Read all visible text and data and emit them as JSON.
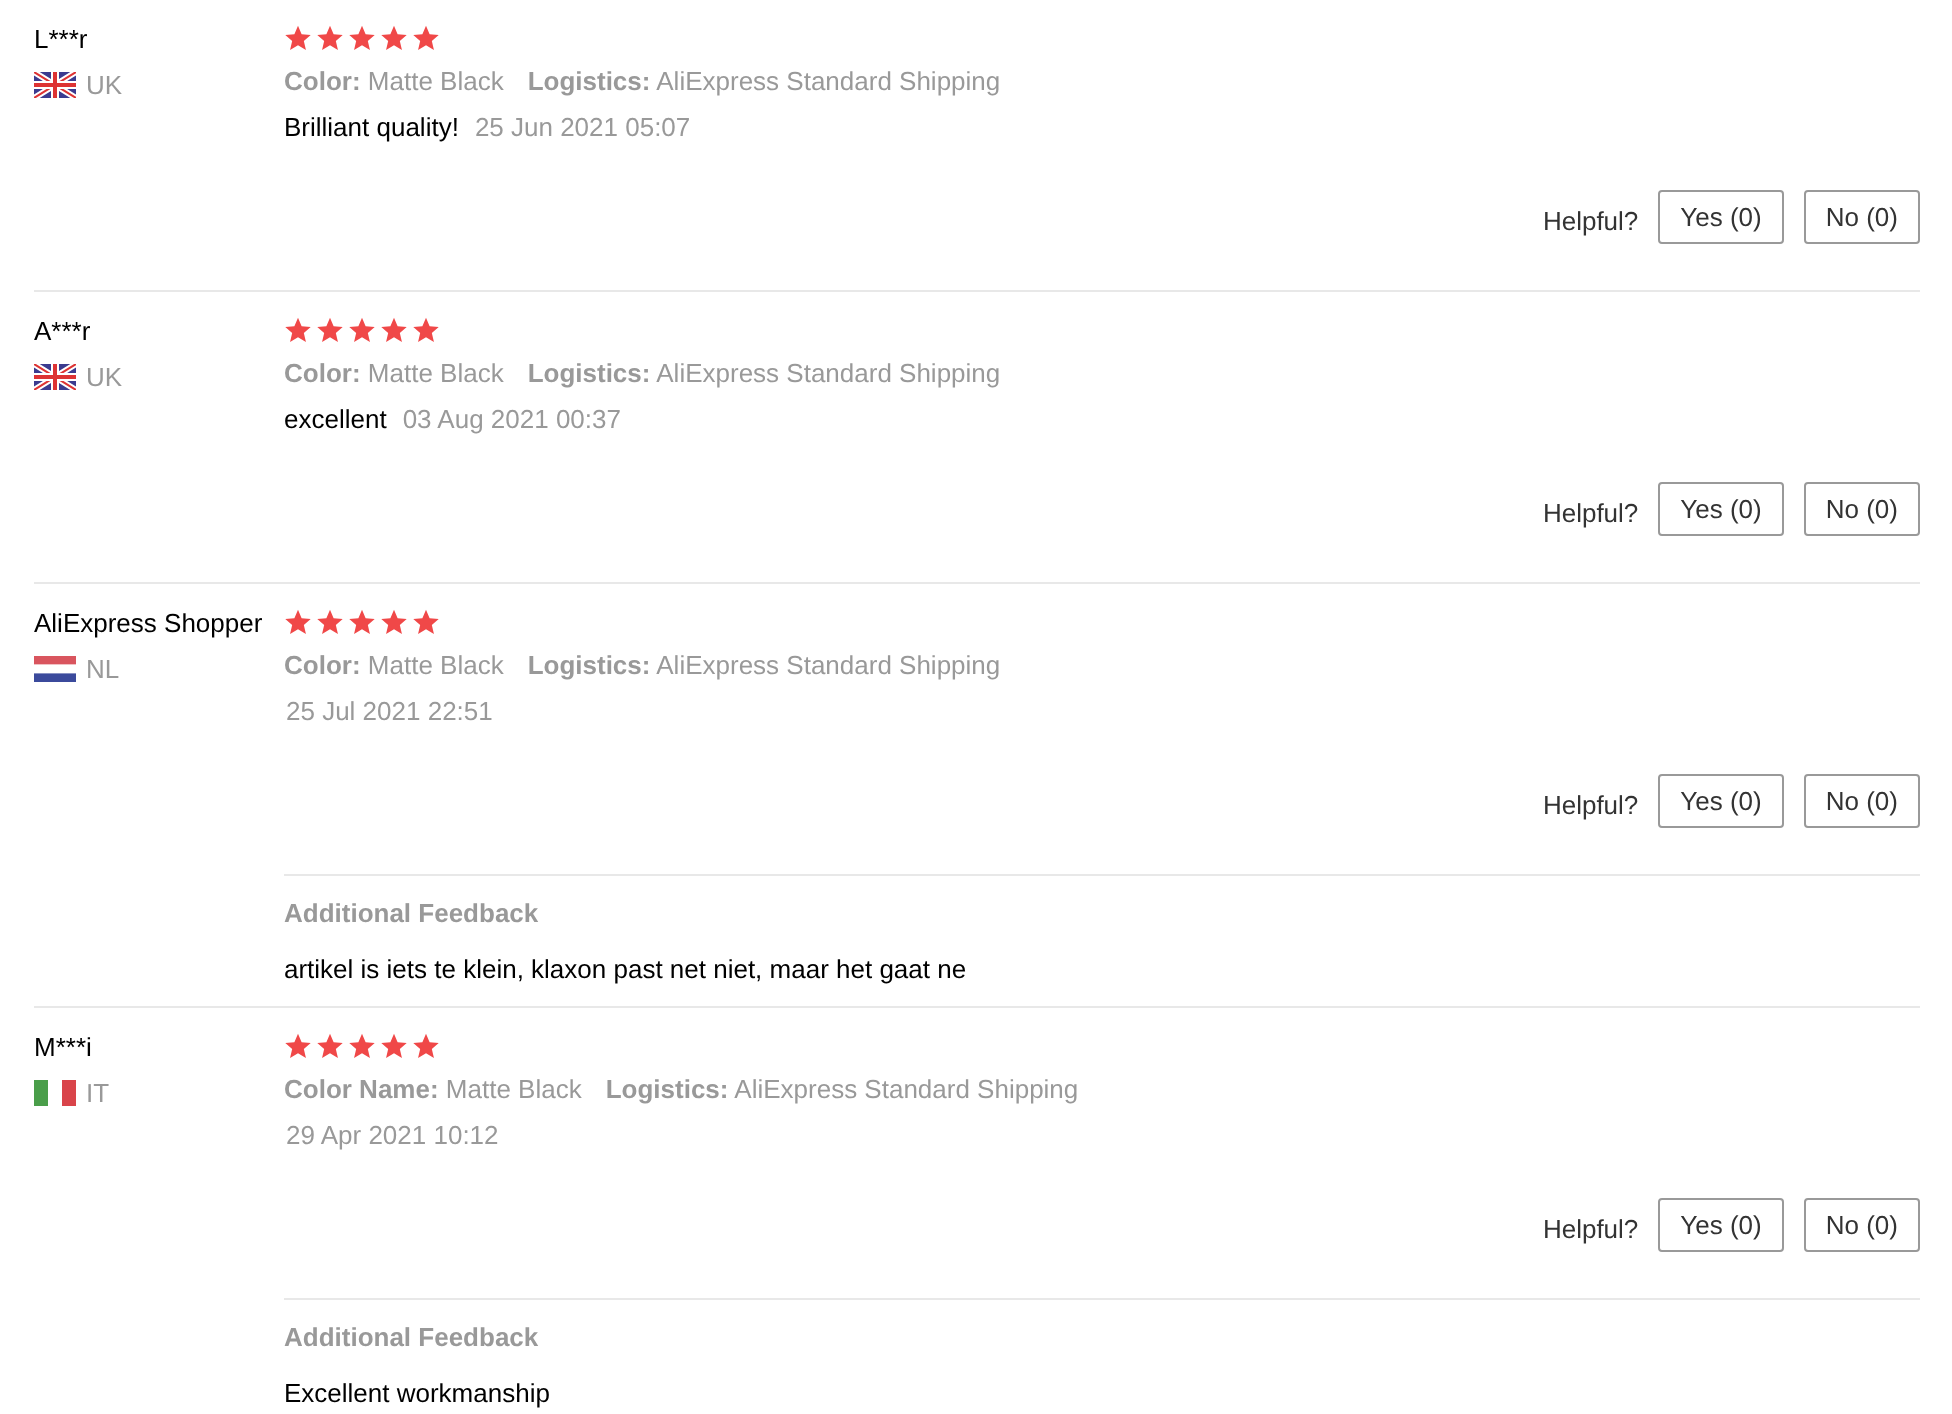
{
  "reviews": [
    {
      "name": "L***r",
      "country": {
        "code": "UK",
        "kind": "uk"
      },
      "stars": 5,
      "properties": [
        {
          "label": "Color:",
          "value": "Matte Black"
        },
        {
          "label": "Logistics:",
          "value": "AliExpress Standard Shipping"
        }
      ],
      "comment": "Brilliant quality!",
      "date": "25 Jun 2021 05:07",
      "helpful_label": "Helpful?",
      "yes": "Yes (0)",
      "no": "No (0)"
    },
    {
      "name": "A***r",
      "country": {
        "code": "UK",
        "kind": "uk"
      },
      "stars": 5,
      "properties": [
        {
          "label": "Color:",
          "value": "Matte Black"
        },
        {
          "label": "Logistics:",
          "value": "AliExpress Standard Shipping"
        }
      ],
      "comment": "excellent",
      "date": "03 Aug 2021 00:37",
      "helpful_label": "Helpful?",
      "yes": "Yes (0)",
      "no": "No (0)"
    },
    {
      "name": "AliExpress Shopper",
      "country": {
        "code": "NL",
        "kind": "nl"
      },
      "stars": 5,
      "properties": [
        {
          "label": "Color:",
          "value": "Matte Black"
        },
        {
          "label": "Logistics:",
          "value": "AliExpress Standard Shipping"
        }
      ],
      "date": "25 Jul 2021 22:51",
      "helpful_label": "Helpful?",
      "yes": "Yes (0)",
      "no": "No (0)",
      "additional": {
        "title": "Additional Feedback",
        "text": "artikel is iets te klein, klaxon past net niet, maar het gaat ne"
      }
    },
    {
      "name": "M***i",
      "country": {
        "code": "IT",
        "kind": "it"
      },
      "stars": 5,
      "properties": [
        {
          "label": "Color Name:",
          "value": "Matte Black"
        },
        {
          "label": "Logistics:",
          "value": "AliExpress Standard Shipping"
        }
      ],
      "date": "29 Apr 2021 10:12",
      "helpful_label": "Helpful?",
      "yes": "Yes (0)",
      "no": "No (0)",
      "additional": {
        "title": "Additional Feedback",
        "text": "Excellent workmanship"
      }
    }
  ]
}
